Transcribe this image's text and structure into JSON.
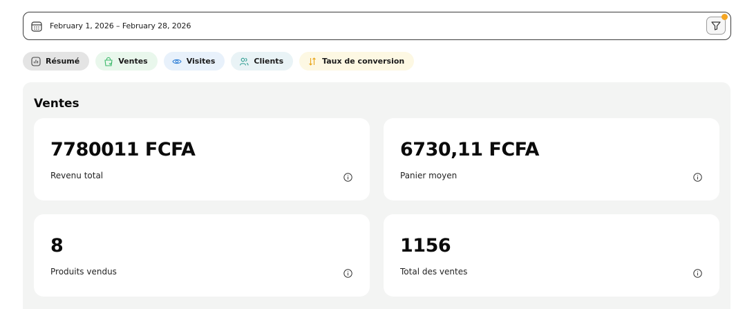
{
  "date_range": {
    "text": "February 1, 2026 – February 28, 2026",
    "icon": "calendar-icon"
  },
  "filter": {
    "icon": "filter-icon",
    "badge_color": "#f5a623"
  },
  "tabs": [
    {
      "label": "Résumé",
      "icon": "bar-chart-icon",
      "active": true,
      "color": "#e4e4e4"
    },
    {
      "label": "Ventes",
      "icon": "shopping-bag-icon",
      "color": "#e9f7ec",
      "icon_color": "#3bb86a"
    },
    {
      "label": "Visites",
      "icon": "eye-icon",
      "color": "#e8f1fb",
      "icon_color": "#2f7fd6"
    },
    {
      "label": "Clients",
      "icon": "users-icon",
      "color": "#e9f3f6",
      "icon_color": "#2a9b8f"
    },
    {
      "label": "Taux de conversion",
      "icon": "sort-arrows-icon",
      "color": "#fdf8e3",
      "icon_color": "#e8a317"
    }
  ],
  "section": {
    "title": "Ventes",
    "cards": [
      {
        "value": "7780011 FCFA",
        "label": "Revenu total"
      },
      {
        "value": "6730,11 FCFA",
        "label": "Panier moyen"
      },
      {
        "value": "8",
        "label": "Produits vendus"
      },
      {
        "value": "1156",
        "label": "Total des ventes"
      }
    ]
  }
}
